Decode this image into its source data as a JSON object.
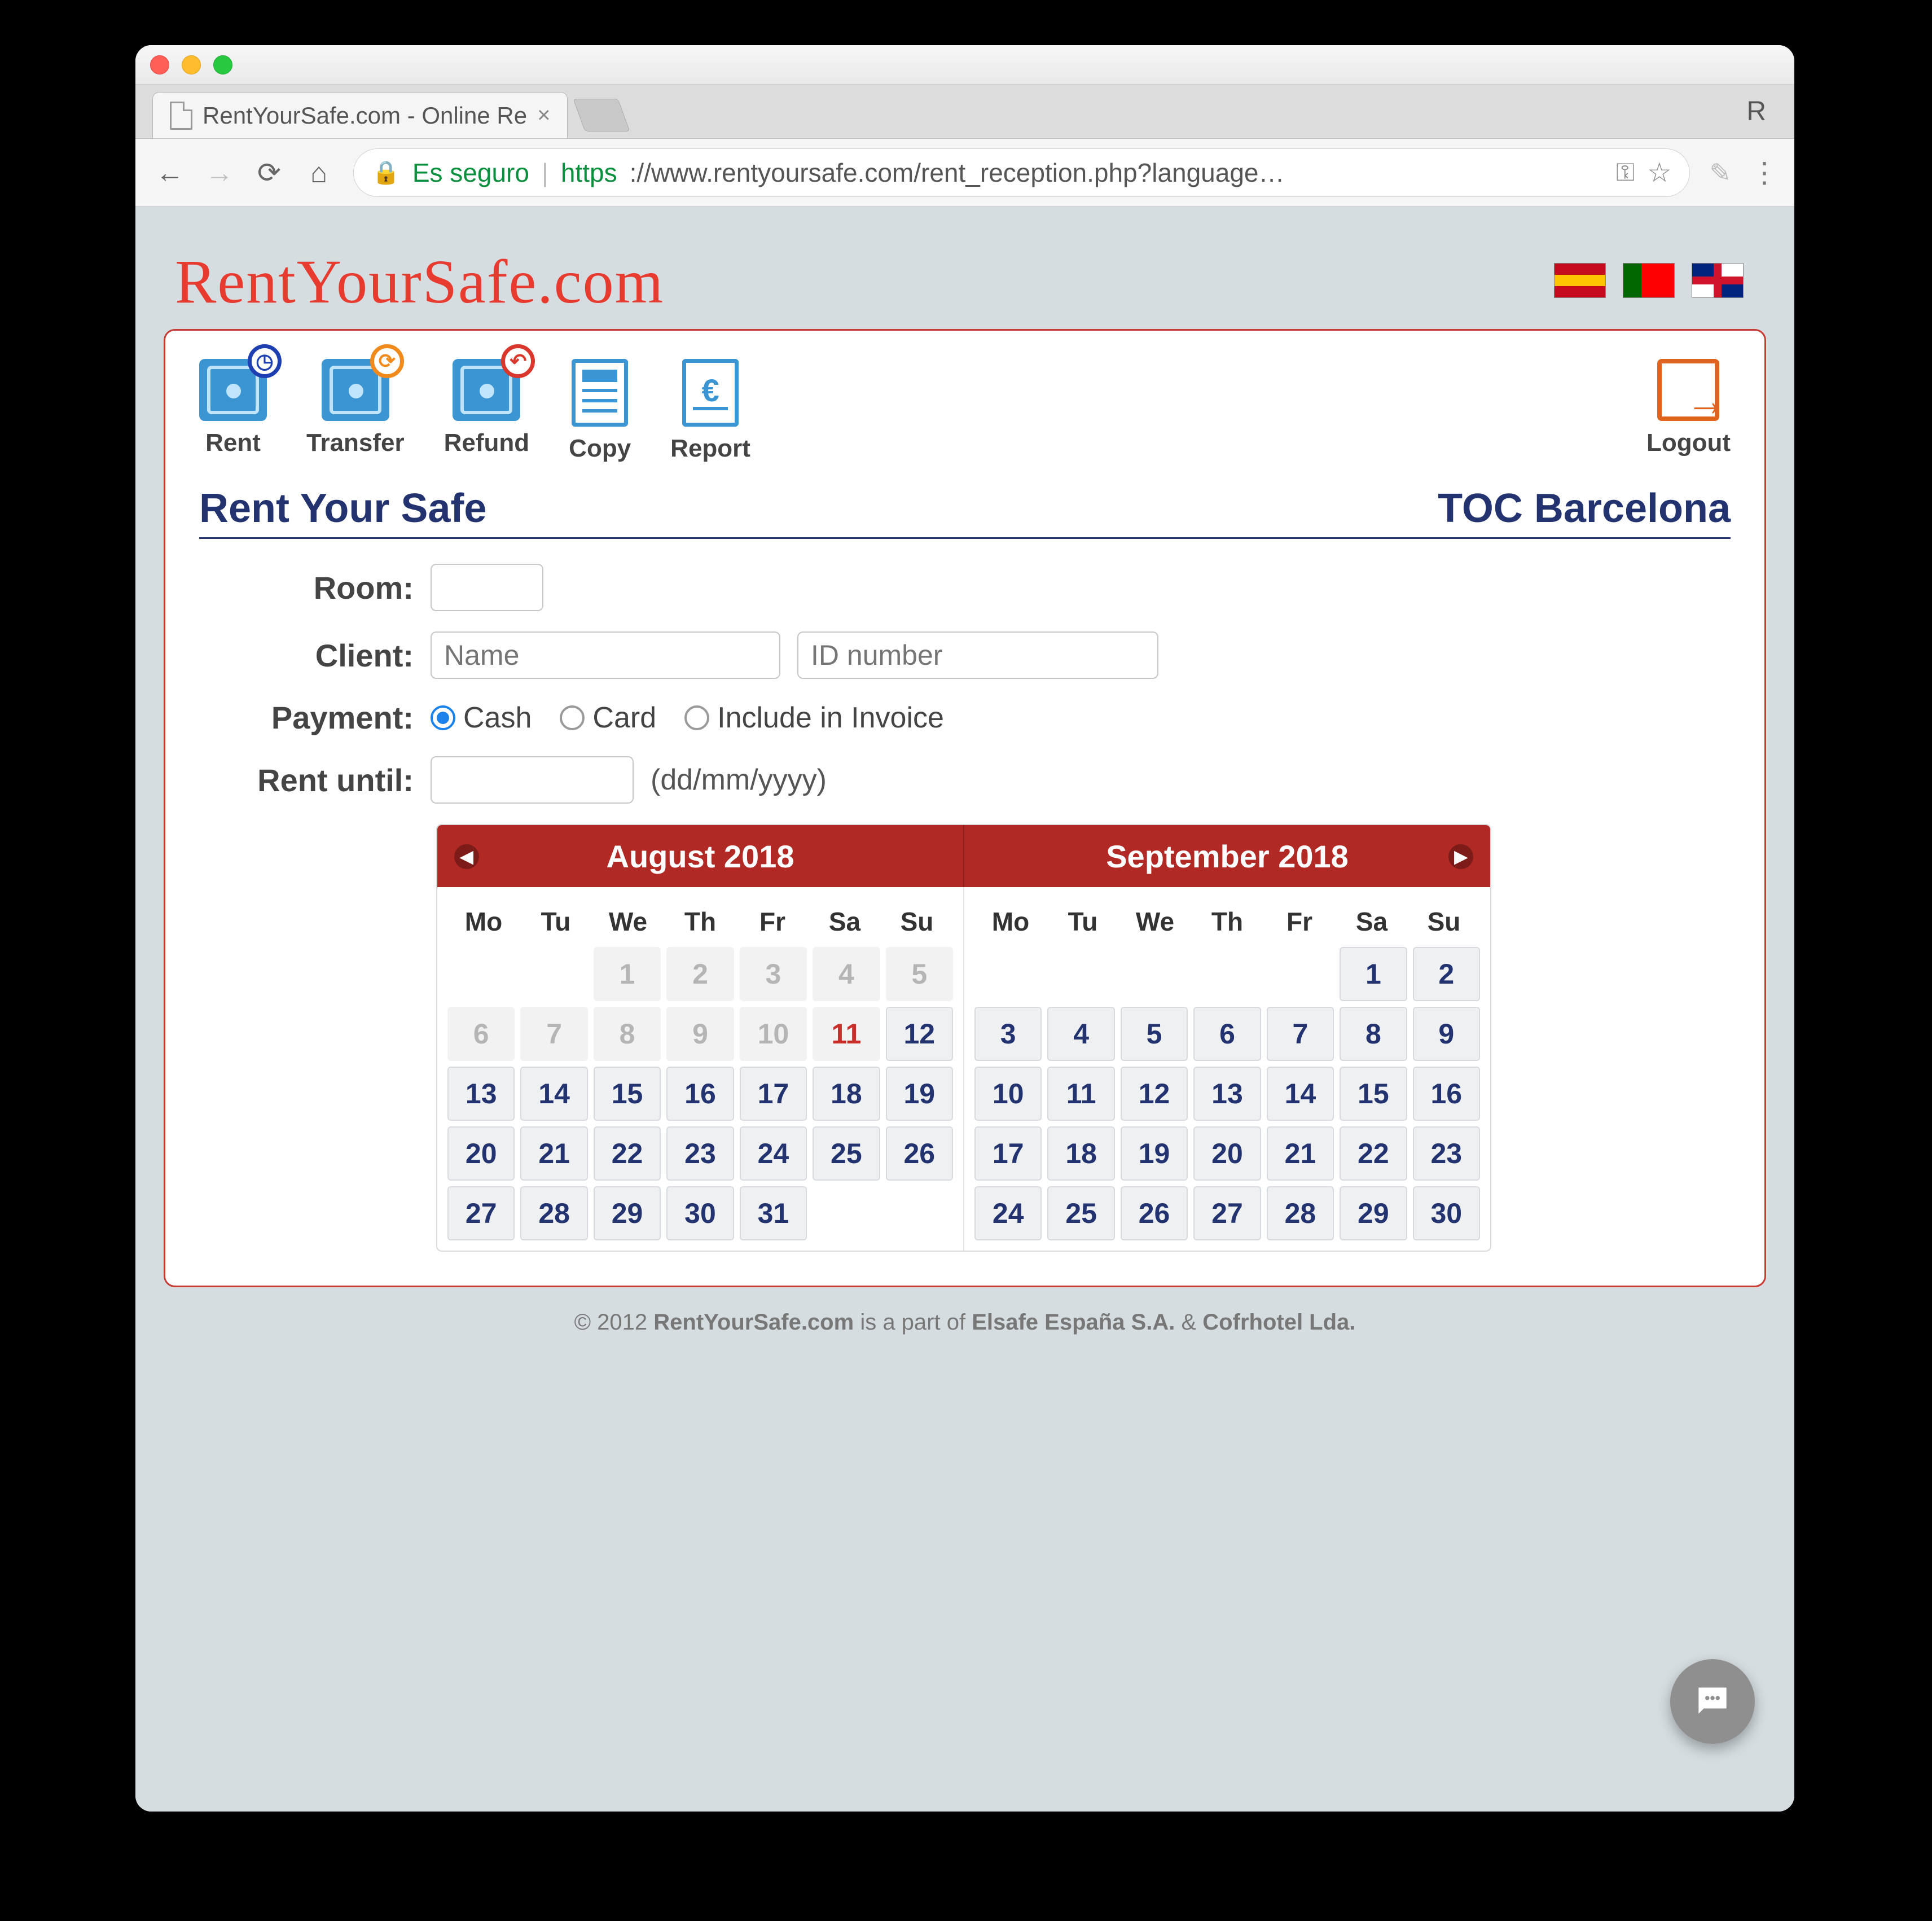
{
  "browser": {
    "tab_title": "RentYourSafe.com - Online Re",
    "profile_letter": "R",
    "secure_label": "Es seguro",
    "url_scheme": "https",
    "url_rest": "://www.rentyoursafe.com/rent_reception.php?language…"
  },
  "brand": "RentYourSafe.com",
  "languages": [
    "es",
    "pt",
    "uk"
  ],
  "toolbar": {
    "rent": "Rent",
    "transfer": "Transfer",
    "refund": "Refund",
    "copy": "Copy",
    "report": "Report",
    "logout": "Logout"
  },
  "heading": {
    "left": "Rent Your Safe",
    "right": "TOC Barcelona"
  },
  "form": {
    "room_label": "Room:",
    "room_value": "",
    "client_label": "Client:",
    "client_name_placeholder": "Name",
    "client_id_placeholder": "ID number",
    "payment_label": "Payment:",
    "payment_options": {
      "cash": "Cash",
      "card": "Card",
      "invoice": "Include in Invoice"
    },
    "payment_selected": "cash",
    "rent_until_label": "Rent until:",
    "rent_until_value": "",
    "date_hint": "(dd/mm/yyyy)"
  },
  "calendar": {
    "dow": [
      "Mo",
      "Tu",
      "We",
      "Th",
      "Fr",
      "Sa",
      "Su"
    ],
    "months": [
      {
        "title": "August 2018",
        "leading_blanks": 2,
        "days": [
          {
            "n": 1,
            "state": "dis"
          },
          {
            "n": 2,
            "state": "dis"
          },
          {
            "n": 3,
            "state": "dis"
          },
          {
            "n": 4,
            "state": "dis"
          },
          {
            "n": 5,
            "state": "dis"
          },
          {
            "n": 6,
            "state": "dis"
          },
          {
            "n": 7,
            "state": "dis"
          },
          {
            "n": 8,
            "state": "dis"
          },
          {
            "n": 9,
            "state": "dis"
          },
          {
            "n": 10,
            "state": "dis"
          },
          {
            "n": 11,
            "state": "dis today"
          },
          {
            "n": 12,
            "state": "act"
          },
          {
            "n": 13,
            "state": "act"
          },
          {
            "n": 14,
            "state": "act"
          },
          {
            "n": 15,
            "state": "act"
          },
          {
            "n": 16,
            "state": "act"
          },
          {
            "n": 17,
            "state": "act"
          },
          {
            "n": 18,
            "state": "act"
          },
          {
            "n": 19,
            "state": "act"
          },
          {
            "n": 20,
            "state": "act"
          },
          {
            "n": 21,
            "state": "act"
          },
          {
            "n": 22,
            "state": "act"
          },
          {
            "n": 23,
            "state": "act"
          },
          {
            "n": 24,
            "state": "act"
          },
          {
            "n": 25,
            "state": "act"
          },
          {
            "n": 26,
            "state": "act"
          },
          {
            "n": 27,
            "state": "act"
          },
          {
            "n": 28,
            "state": "act"
          },
          {
            "n": 29,
            "state": "act"
          },
          {
            "n": 30,
            "state": "act"
          },
          {
            "n": 31,
            "state": "act"
          }
        ]
      },
      {
        "title": "September 2018",
        "leading_blanks": 5,
        "days": [
          {
            "n": 1,
            "state": "act"
          },
          {
            "n": 2,
            "state": "act"
          },
          {
            "n": 3,
            "state": "act"
          },
          {
            "n": 4,
            "state": "act"
          },
          {
            "n": 5,
            "state": "act"
          },
          {
            "n": 6,
            "state": "act"
          },
          {
            "n": 7,
            "state": "act"
          },
          {
            "n": 8,
            "state": "act"
          },
          {
            "n": 9,
            "state": "act"
          },
          {
            "n": 10,
            "state": "act"
          },
          {
            "n": 11,
            "state": "act"
          },
          {
            "n": 12,
            "state": "act"
          },
          {
            "n": 13,
            "state": "act"
          },
          {
            "n": 14,
            "state": "act"
          },
          {
            "n": 15,
            "state": "act"
          },
          {
            "n": 16,
            "state": "act"
          },
          {
            "n": 17,
            "state": "act"
          },
          {
            "n": 18,
            "state": "act"
          },
          {
            "n": 19,
            "state": "act"
          },
          {
            "n": 20,
            "state": "act"
          },
          {
            "n": 21,
            "state": "act"
          },
          {
            "n": 22,
            "state": "act"
          },
          {
            "n": 23,
            "state": "act"
          },
          {
            "n": 24,
            "state": "act"
          },
          {
            "n": 25,
            "state": "act"
          },
          {
            "n": 26,
            "state": "act"
          },
          {
            "n": 27,
            "state": "act"
          },
          {
            "n": 28,
            "state": "act"
          },
          {
            "n": 29,
            "state": "act"
          },
          {
            "n": 30,
            "state": "act"
          }
        ]
      }
    ]
  },
  "footer": {
    "copyright": "© 2012",
    "site": "RentYourSafe.com",
    "mid": "is a part of",
    "co1": "Elsafe España S.A.",
    "amp": "&",
    "co2": "Cofrhotel Lda."
  }
}
